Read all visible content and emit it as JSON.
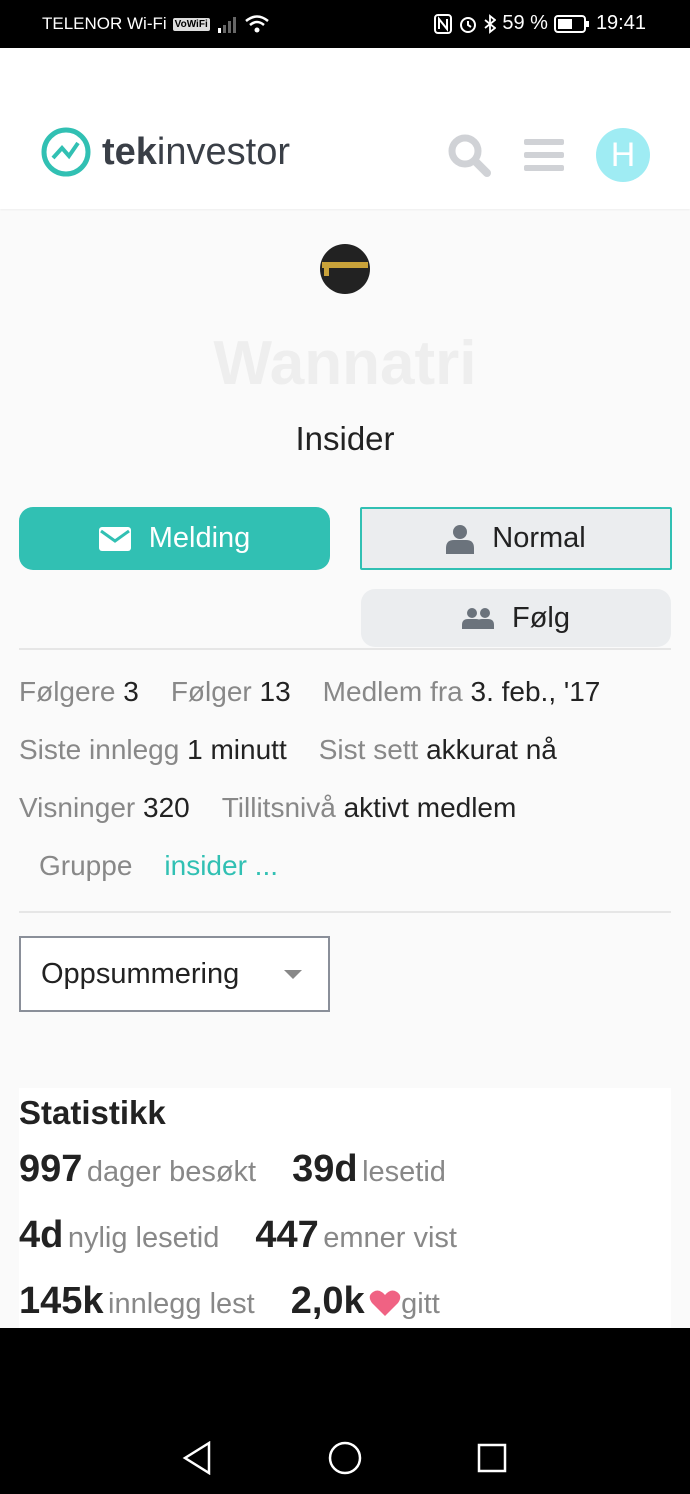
{
  "status_bar": {
    "carrier": "TELENOR Wi-Fi",
    "vowifi": "VoWiFi",
    "battery": "59 %",
    "time": "19:41"
  },
  "header": {
    "logo_bold": "tek",
    "logo_light": "investor",
    "avatar_letter": "H"
  },
  "profile": {
    "username": "Wannatri",
    "title": "Insider"
  },
  "buttons": {
    "message": "Melding",
    "normal": "Normal",
    "follow": "Følg"
  },
  "meta": {
    "followers_label": "Følgere",
    "followers": "3",
    "following_label": "Følger",
    "following": "13",
    "member_label": "Medlem fra",
    "member": "3. feb., '17",
    "last_post_label": "Siste innlegg",
    "last_post": "1 minutt",
    "last_seen_label": "Sist sett",
    "last_seen": "akkurat nå",
    "views_label": "Visninger",
    "views": "320",
    "trust_label": "Tillitsnivå",
    "trust": "aktivt medlem",
    "group_label": "Gruppe",
    "group": "insider ..."
  },
  "dropdown": {
    "selected": "Oppsummering"
  },
  "stats": {
    "title": "Statistikk",
    "items": [
      {
        "value": "997",
        "label": "dager besøkt"
      },
      {
        "value": "39d",
        "label": "lesetid"
      },
      {
        "value": "4d",
        "label": "nylig lesetid"
      },
      {
        "value": "447",
        "label": "emner vist"
      },
      {
        "value": "145k",
        "label": "innlegg lest"
      },
      {
        "value": "2,0k",
        "label": "gitt"
      }
    ]
  },
  "colors": {
    "accent": "#31c0b3",
    "heart": "#f06283",
    "avatar_bg": "#9fecf3"
  }
}
